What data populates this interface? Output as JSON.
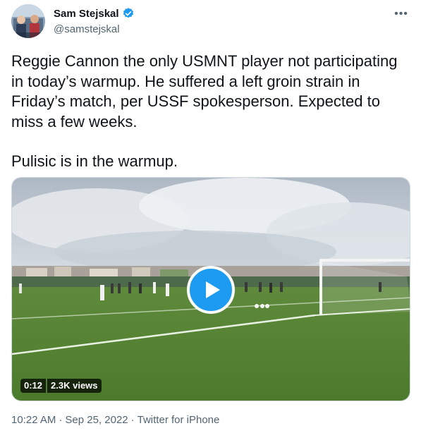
{
  "tweet": {
    "author": {
      "display_name": "Sam Stejskal",
      "handle": "@samstejskal",
      "verified": true
    },
    "text_paragraphs": [
      "Reggie Cannon the only USMNT player not participating in today’s warmup. He suffered a left groin strain in Friday’s match, per USSF spokesperson. Expected to miss a few weeks.",
      "Pulisic is in the warmup."
    ],
    "media": {
      "type": "video",
      "duration": "0:12",
      "views": "2.3K views"
    },
    "meta": {
      "time": "10:22 AM",
      "separator": "·",
      "date": "Sep 25, 2022",
      "source": "Twitter for iPhone"
    }
  },
  "icons": {
    "verified": "verified-badge-icon",
    "more": "more-options-icon",
    "play": "play-icon"
  },
  "colors": {
    "accent": "#1d9bf0",
    "text_primary": "#0f1419",
    "text_secondary": "#536471"
  }
}
